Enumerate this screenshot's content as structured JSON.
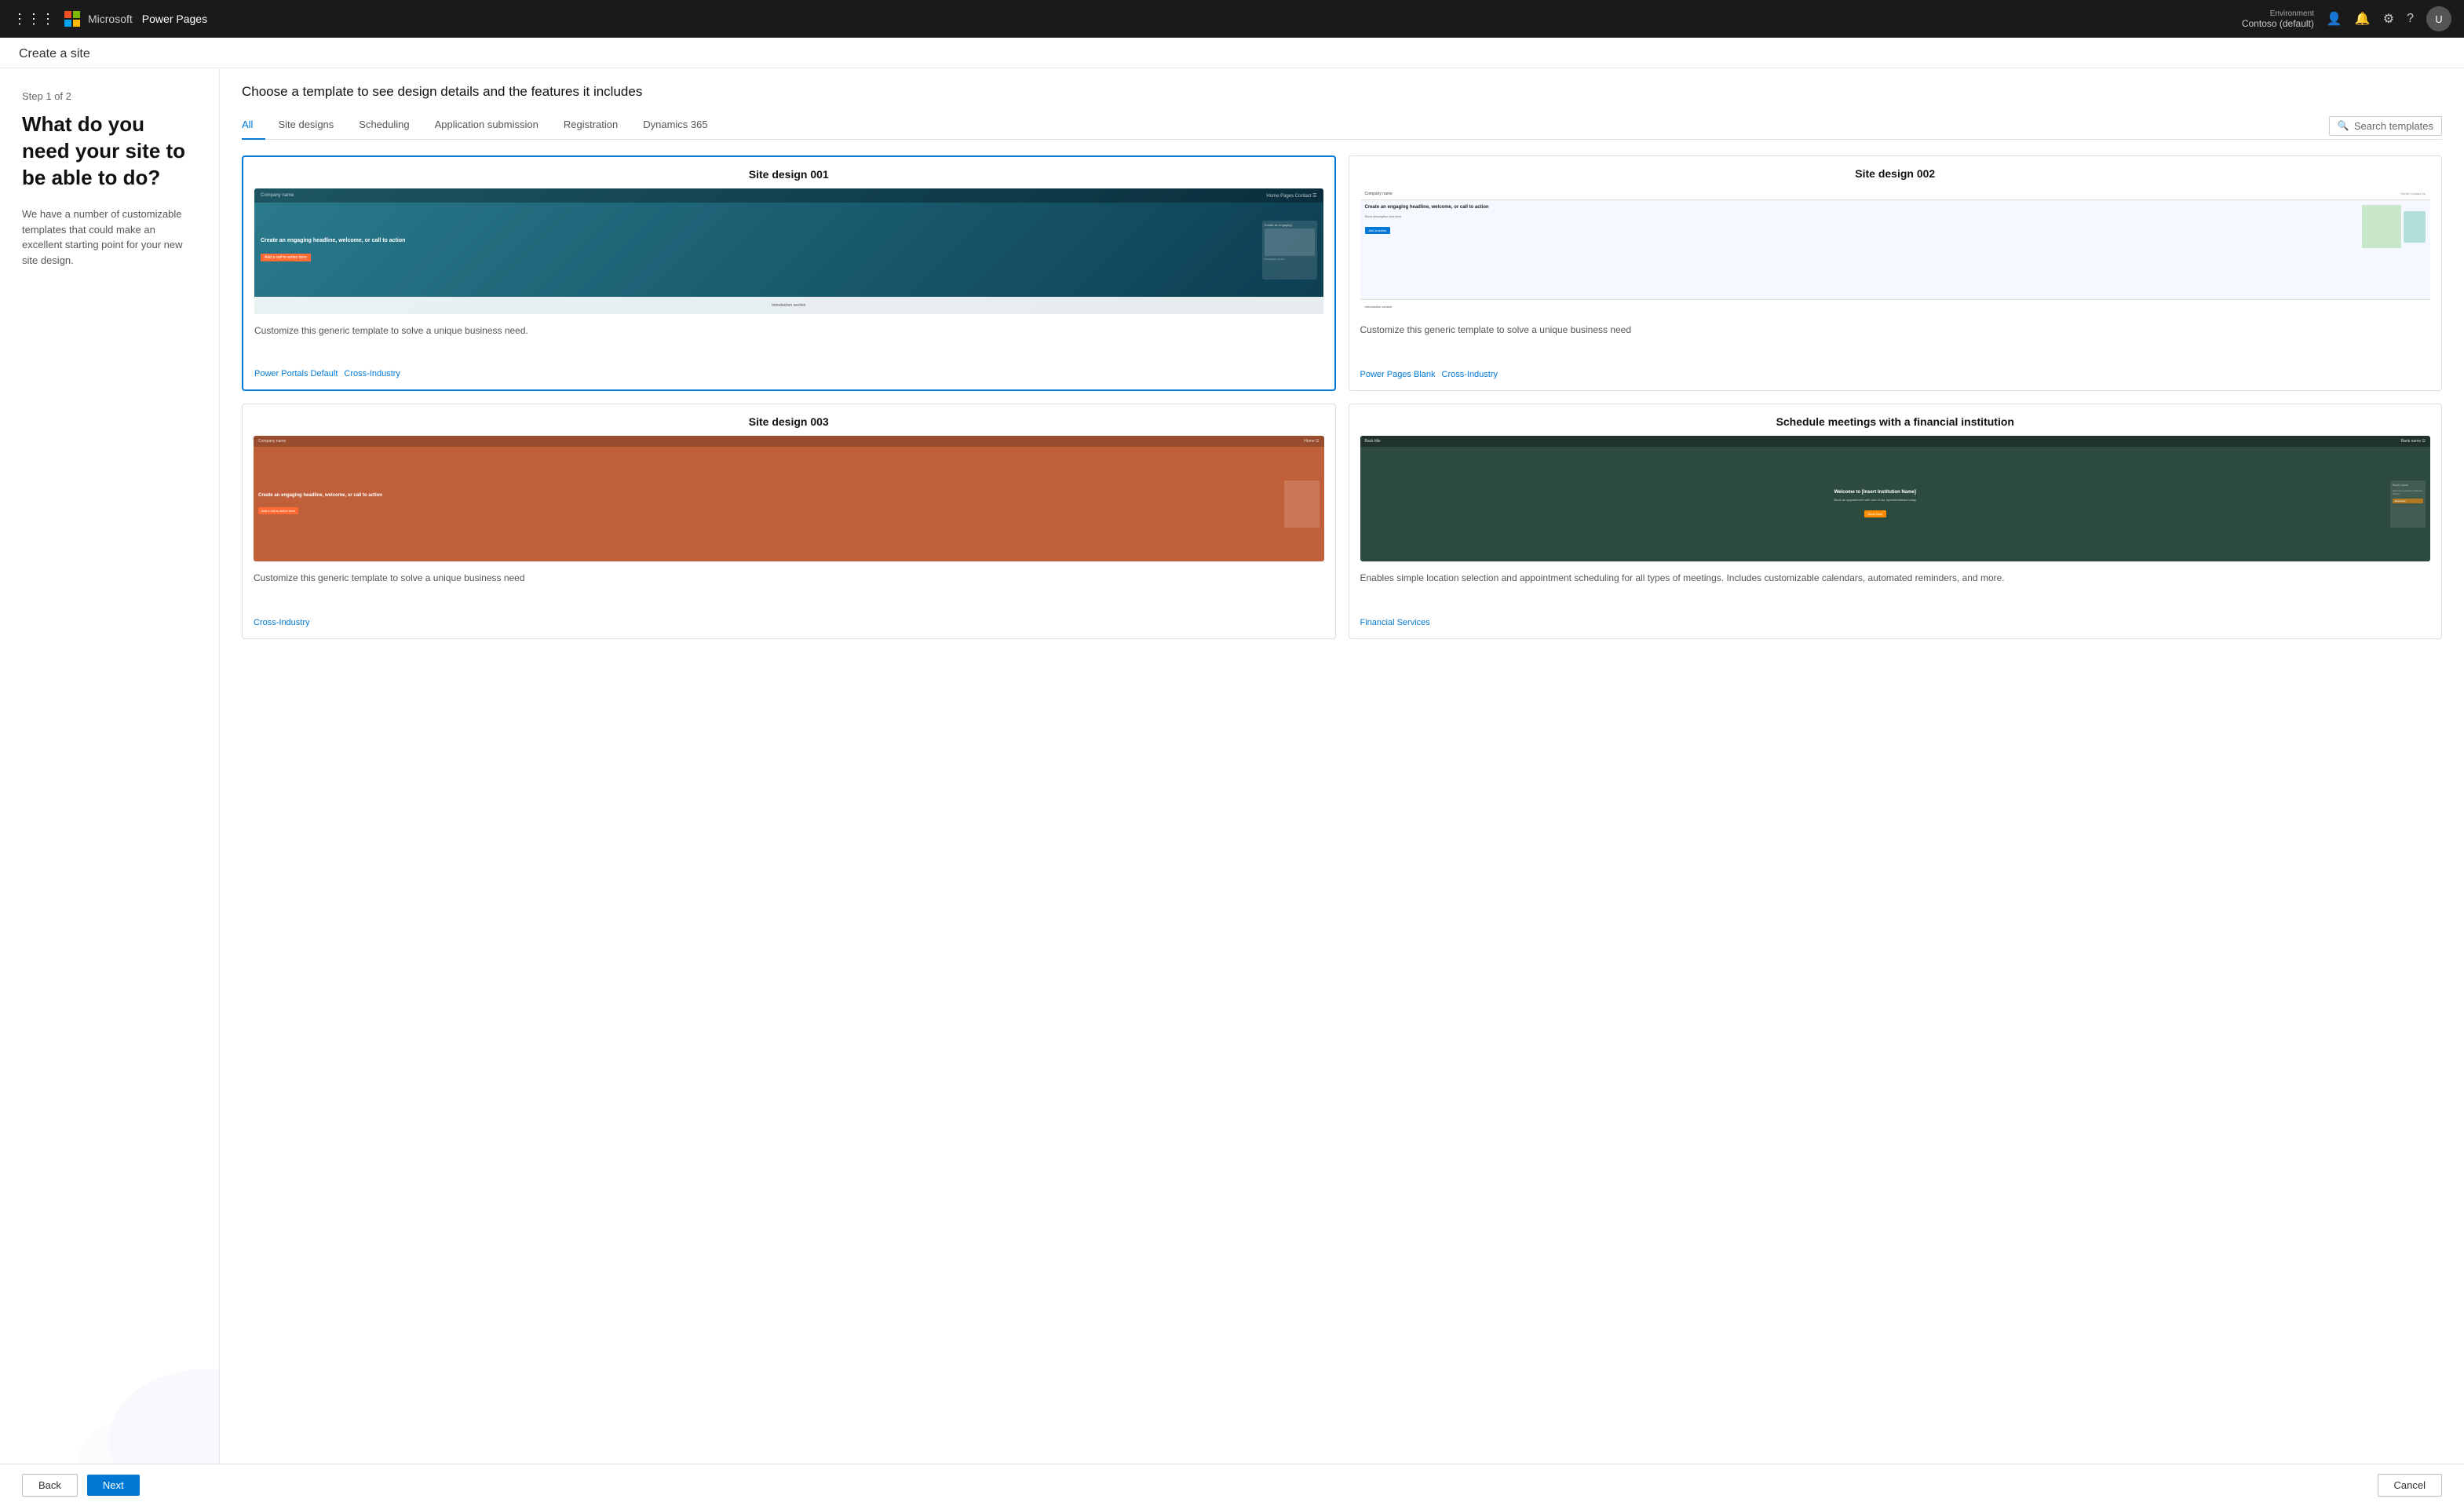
{
  "topnav": {
    "brand": "Microsoft",
    "appname": "Power Pages",
    "environment_label": "Environment",
    "environment_value": "Contoso (default)",
    "waffle_icon": "⊞",
    "bell_icon": "🔔",
    "settings_icon": "⚙",
    "help_icon": "?",
    "avatar_text": "U"
  },
  "page": {
    "title": "Create a site"
  },
  "sidebar": {
    "step": "Step 1 of 2",
    "heading": "What do you need your site to be able to do?",
    "description": "We have a number of customizable templates that could make an excellent starting point for your new site design."
  },
  "content": {
    "choose_template_heading": "Choose a template to see design details and the features it includes",
    "search_placeholder": "Search templates"
  },
  "tabs": [
    {
      "id": "all",
      "label": "All",
      "active": true
    },
    {
      "id": "site-designs",
      "label": "Site designs",
      "active": false
    },
    {
      "id": "scheduling",
      "label": "Scheduling",
      "active": false
    },
    {
      "id": "application-submission",
      "label": "Application submission",
      "active": false
    },
    {
      "id": "registration",
      "label": "Registration",
      "active": false
    },
    {
      "id": "dynamics-365",
      "label": "Dynamics 365",
      "active": false
    }
  ],
  "templates": [
    {
      "id": "site-design-001",
      "title": "Site design 001",
      "description": "Customize this generic template to solve a unique business need.",
      "tags": [
        "Power Portals Default",
        "Cross-Industry"
      ],
      "selected": true,
      "preview_type": "001"
    },
    {
      "id": "site-design-002",
      "title": "Site design 002",
      "description": "Customize this generic template to solve a unique business need",
      "tags": [
        "Power Pages Blank",
        "Cross-Industry"
      ],
      "selected": false,
      "preview_type": "002"
    },
    {
      "id": "site-design-003",
      "title": "Site design 003",
      "description": "Customize this generic template to solve a unique business need",
      "tags": [
        "Cross-Industry"
      ],
      "selected": false,
      "preview_type": "003"
    },
    {
      "id": "schedule-meetings",
      "title": "Schedule meetings with a financial institution",
      "description": "Enables simple location selection and appointment scheduling for all types of meetings. Includes customizable calendars, automated reminders, and more.",
      "tags": [
        "Financial Services"
      ],
      "selected": false,
      "preview_type": "finance"
    }
  ],
  "buttons": {
    "back": "Back",
    "next": "Next",
    "cancel": "Cancel"
  }
}
